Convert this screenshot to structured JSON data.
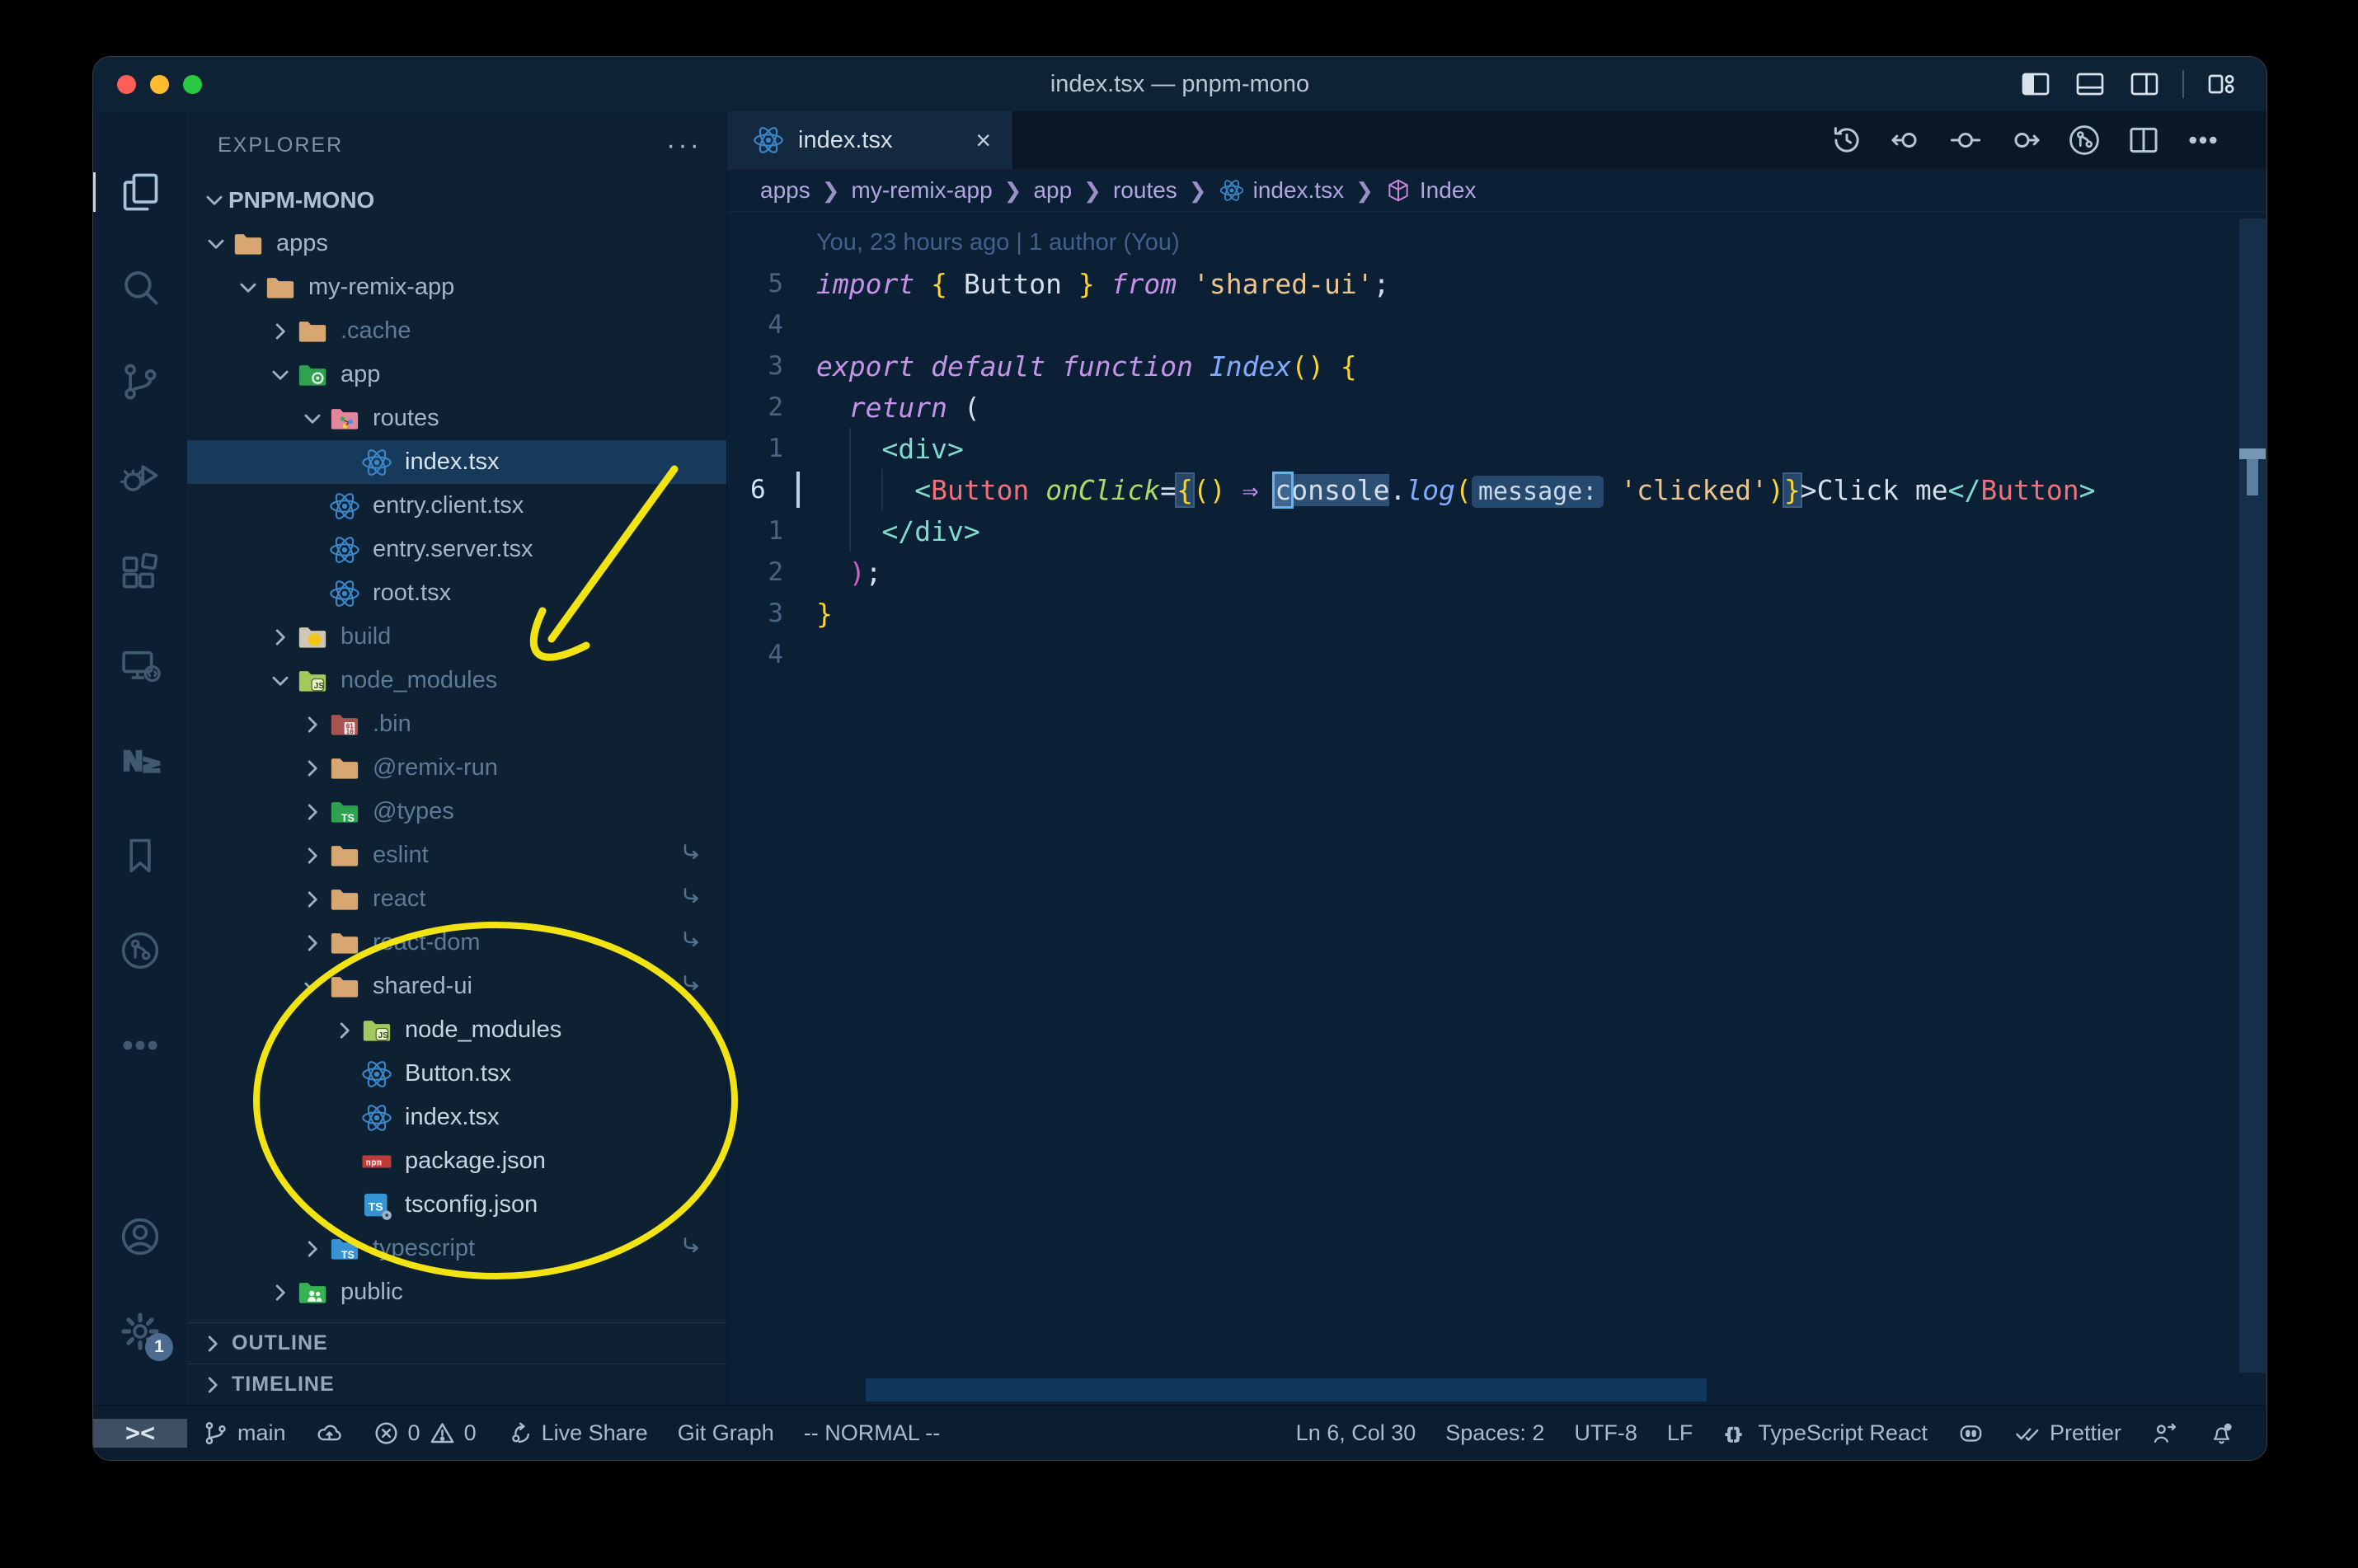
{
  "window": {
    "title": "index.tsx — pnpm-mono",
    "traffic_lights": [
      "close",
      "minimize",
      "zoom"
    ],
    "titlebar_controls": [
      "toggle-primary-sidebar",
      "toggle-panel",
      "toggle-secondary-sidebar",
      "customize-layout"
    ]
  },
  "colors": {
    "editor_bg": "#0b2035",
    "sidebar_bg": "#0d2133",
    "tabbar_bg": "#0a1728",
    "titlebar_bg": "#0e2236",
    "statusbar_bg": "#0b1e30",
    "selection_row": "#17395a",
    "annotation_yellow": "#f2e313",
    "keyword_pink": "#c792ea",
    "brace_yellow": "#fad430",
    "string_orange": "#ecc48d",
    "tag_teal": "#7fdbca",
    "component_salmon": "#f07178",
    "attr_green": "#addb67",
    "fn_blue": "#82aaff",
    "breadcrumb_purple": "#b1a6e0"
  },
  "activity_bar": {
    "top": [
      {
        "name": "explorer",
        "active": true
      },
      {
        "name": "search",
        "active": false
      },
      {
        "name": "source-control",
        "active": false
      },
      {
        "name": "run-debug",
        "active": false
      },
      {
        "name": "extensions",
        "active": false
      },
      {
        "name": "remote-explorer",
        "active": false
      },
      {
        "name": "nx-console",
        "active": false
      },
      {
        "name": "bookmarks",
        "active": false
      },
      {
        "name": "gitlens",
        "active": false
      },
      {
        "name": "more",
        "active": false
      }
    ],
    "bottom": [
      {
        "name": "account"
      },
      {
        "name": "settings",
        "badge": "1"
      }
    ]
  },
  "sidebar": {
    "header": "EXPLORER",
    "header_actions": "···",
    "project": "PNPM-MONO",
    "tree": [
      {
        "label": "apps",
        "depth": 0,
        "icon": "folder-tan",
        "chevron": "down"
      },
      {
        "label": "my-remix-app",
        "depth": 1,
        "icon": "folder-tan",
        "chevron": "down"
      },
      {
        "label": ".cache",
        "depth": 2,
        "icon": "folder-tan",
        "chevron": "right",
        "dim": true
      },
      {
        "label": "app",
        "depth": 2,
        "icon": "folder-app",
        "chevron": "down"
      },
      {
        "label": "routes",
        "depth": 3,
        "icon": "folder-routes",
        "chevron": "down"
      },
      {
        "label": "index.tsx",
        "depth": 4,
        "icon": "react",
        "chevron": "none",
        "selected": true
      },
      {
        "label": "entry.client.tsx",
        "depth": 3,
        "icon": "react",
        "chevron": "none"
      },
      {
        "label": "entry.server.tsx",
        "depth": 3,
        "icon": "react",
        "chevron": "none"
      },
      {
        "label": "root.tsx",
        "depth": 3,
        "icon": "react",
        "chevron": "none"
      },
      {
        "label": "build",
        "depth": 2,
        "icon": "folder-build",
        "chevron": "right",
        "dim": true
      },
      {
        "label": "node_modules",
        "depth": 2,
        "icon": "folder-node",
        "chevron": "down",
        "dim": true
      },
      {
        "label": ".bin",
        "depth": 3,
        "icon": "folder-bin",
        "chevron": "right",
        "dim": true
      },
      {
        "label": "@remix-run",
        "depth": 3,
        "icon": "folder-tan",
        "chevron": "right",
        "dim": true
      },
      {
        "label": "@types",
        "depth": 3,
        "icon": "folder-types",
        "chevron": "right",
        "dim": true
      },
      {
        "label": "eslint",
        "depth": 3,
        "icon": "folder-tan",
        "chevron": "right",
        "dim": true,
        "symlink": true
      },
      {
        "label": "react",
        "depth": 3,
        "icon": "folder-tan",
        "chevron": "right",
        "dim": true,
        "symlink": true
      },
      {
        "label": "react-dom",
        "depth": 3,
        "icon": "folder-tan",
        "chevron": "right",
        "dim": true,
        "symlink": true
      },
      {
        "label": "shared-ui",
        "depth": 3,
        "icon": "folder-tan",
        "chevron": "down",
        "symlink": true
      },
      {
        "label": "node_modules",
        "depth": 4,
        "icon": "folder-node",
        "chevron": "right",
        "bright": true
      },
      {
        "label": "Button.tsx",
        "depth": 4,
        "icon": "react",
        "chevron": "none",
        "bright": true
      },
      {
        "label": "index.tsx",
        "depth": 4,
        "icon": "react",
        "chevron": "none",
        "bright": true
      },
      {
        "label": "package.json",
        "depth": 4,
        "icon": "npm",
        "chevron": "none",
        "bright": true
      },
      {
        "label": "tsconfig.json",
        "depth": 4,
        "icon": "ts-config",
        "chevron": "none",
        "bright": true
      },
      {
        "label": "typescript",
        "depth": 3,
        "icon": "folder-ts",
        "chevron": "right",
        "dim": true,
        "symlink": true
      },
      {
        "label": "public",
        "depth": 2,
        "icon": "folder-public",
        "chevron": "right"
      }
    ],
    "sections": [
      {
        "label": "OUTLINE"
      },
      {
        "label": "TIMELINE"
      }
    ]
  },
  "editor": {
    "tab": {
      "label": "index.tsx",
      "icon": "react",
      "close": "×"
    },
    "toolbar": [
      "timeline-history",
      "previous-change",
      "current-change",
      "next-change",
      "file-history",
      "split-editor",
      "more-actions"
    ],
    "breadcrumbs": [
      {
        "label": "apps"
      },
      {
        "label": "my-remix-app"
      },
      {
        "label": "app"
      },
      {
        "label": "routes"
      },
      {
        "label": "index.tsx",
        "icon": "react"
      },
      {
        "label": "Index",
        "icon": "symbol-module"
      }
    ],
    "blame": "You, 23 hours ago | 1 author (You)",
    "code_lines": [
      {
        "num": "",
        "blame": true
      },
      {
        "num": "5",
        "tokens": [
          {
            "t": "import",
            "c": "kw"
          },
          {
            "t": " ",
            "c": "txt"
          },
          {
            "t": "{",
            "c": "y"
          },
          {
            "t": " Button ",
            "c": "txt"
          },
          {
            "t": "}",
            "c": "y"
          },
          {
            "t": " from",
            "c": "kw"
          },
          {
            "t": " ",
            "c": "txt"
          },
          {
            "t": "'shared-ui'",
            "c": "str"
          },
          {
            "t": ";",
            "c": "txt"
          }
        ]
      },
      {
        "num": "4",
        "tokens": []
      },
      {
        "num": "3",
        "tokens": [
          {
            "t": "export",
            "c": "kw"
          },
          {
            "t": " ",
            "c": "txt"
          },
          {
            "t": "default",
            "c": "kw"
          },
          {
            "t": " ",
            "c": "txt"
          },
          {
            "t": "function",
            "c": "kw"
          },
          {
            "t": " ",
            "c": "txt"
          },
          {
            "t": "Index",
            "c": "fn"
          },
          {
            "t": "()",
            "c": "y"
          },
          {
            "t": " ",
            "c": "txt"
          },
          {
            "t": "{",
            "c": "y"
          }
        ]
      },
      {
        "num": "2",
        "tokens": [
          {
            "t": "  ",
            "c": "txt"
          },
          {
            "t": "return",
            "c": "kw"
          },
          {
            "t": " (",
            "c": "txt"
          }
        ]
      },
      {
        "num": "1",
        "guides": 1,
        "tokens": [
          {
            "t": "    ",
            "c": "txt"
          },
          {
            "t": "<div>",
            "c": "tag"
          }
        ]
      },
      {
        "num": "6",
        "current": true,
        "guides": 2,
        "tokens": [
          {
            "t": "      ",
            "c": "txt"
          },
          {
            "t": "<",
            "c": "tag"
          },
          {
            "t": "Button",
            "c": "cmp"
          },
          {
            "t": " ",
            "c": "txt"
          },
          {
            "t": "onClick",
            "c": "attr"
          },
          {
            "t": "=",
            "c": "txt"
          },
          {
            "t": "{",
            "c": "yh"
          },
          {
            "t": "()",
            "c": "y"
          },
          {
            "t": " ",
            "c": "txt"
          },
          {
            "t": "⇒",
            "c": "op"
          },
          {
            "t": " ",
            "c": "txt"
          },
          {
            "t": "c",
            "c": "cur whl"
          },
          {
            "t": "onsole",
            "c": "whl"
          },
          {
            "t": ".",
            "c": "txt"
          },
          {
            "t": "log",
            "c": "fn"
          },
          {
            "t": "(",
            "c": "y"
          },
          {
            "t": "message:",
            "c": "inlay"
          },
          {
            "t": " ",
            "c": "txt"
          },
          {
            "t": "'clicked'",
            "c": "str"
          },
          {
            "t": ")",
            "c": "y"
          },
          {
            "t": "}",
            "c": "yh"
          },
          {
            "t": ">",
            "c": "txt"
          },
          {
            "t": "Click me",
            "c": "txt"
          },
          {
            "t": "</",
            "c": "tag"
          },
          {
            "t": "Button",
            "c": "cmp"
          },
          {
            "t": ">",
            "c": "tag"
          }
        ]
      },
      {
        "num": "1",
        "guides": 1,
        "tokens": [
          {
            "t": "    ",
            "c": "txt"
          },
          {
            "t": "</div>",
            "c": "tag"
          }
        ]
      },
      {
        "num": "2",
        "tokens": [
          {
            "t": "  ",
            "c": "txt"
          },
          {
            "t": ")",
            "c": "pr"
          },
          {
            "t": ";",
            "c": "txt"
          }
        ]
      },
      {
        "num": "3",
        "tokens": [
          {
            "t": "}",
            "c": "y"
          }
        ]
      },
      {
        "num": "4",
        "tokens": []
      }
    ]
  },
  "status_bar": {
    "left": [
      {
        "name": "remote-indicator",
        "remote": true,
        "glyph": "><"
      },
      {
        "name": "git-branch",
        "icon": "branch",
        "label": "main"
      },
      {
        "name": "sync-changes",
        "icon": "cloud-upload",
        "label": ""
      },
      {
        "name": "problems",
        "icon": "error",
        "label": "0",
        "icon2": "warning",
        "label2": "0"
      },
      {
        "name": "live-share",
        "icon": "liveshare",
        "label": "Live Share"
      },
      {
        "name": "git-graph",
        "label": "Git Graph"
      },
      {
        "name": "vim-mode",
        "label": "-- NORMAL --"
      }
    ],
    "right": [
      {
        "name": "cursor-position",
        "label": "Ln 6, Col 30"
      },
      {
        "name": "indentation",
        "label": "Spaces: 2"
      },
      {
        "name": "encoding",
        "label": "UTF-8"
      },
      {
        "name": "eol",
        "label": "LF"
      },
      {
        "name": "language-mode",
        "icon": "braces",
        "label": "TypeScript React"
      },
      {
        "name": "copilot",
        "icon": "copilot",
        "label": ""
      },
      {
        "name": "formatter",
        "icon": "double-check",
        "label": "Prettier"
      },
      {
        "name": "feedback",
        "icon": "person-arrow",
        "label": ""
      },
      {
        "name": "notifications",
        "icon": "bell-dot",
        "label": ""
      }
    ]
  },
  "annotations": [
    "hand-drawn yellow arrow pointing at node_modules folder",
    "hand-drawn yellow ellipse circling shared-ui package contents"
  ]
}
